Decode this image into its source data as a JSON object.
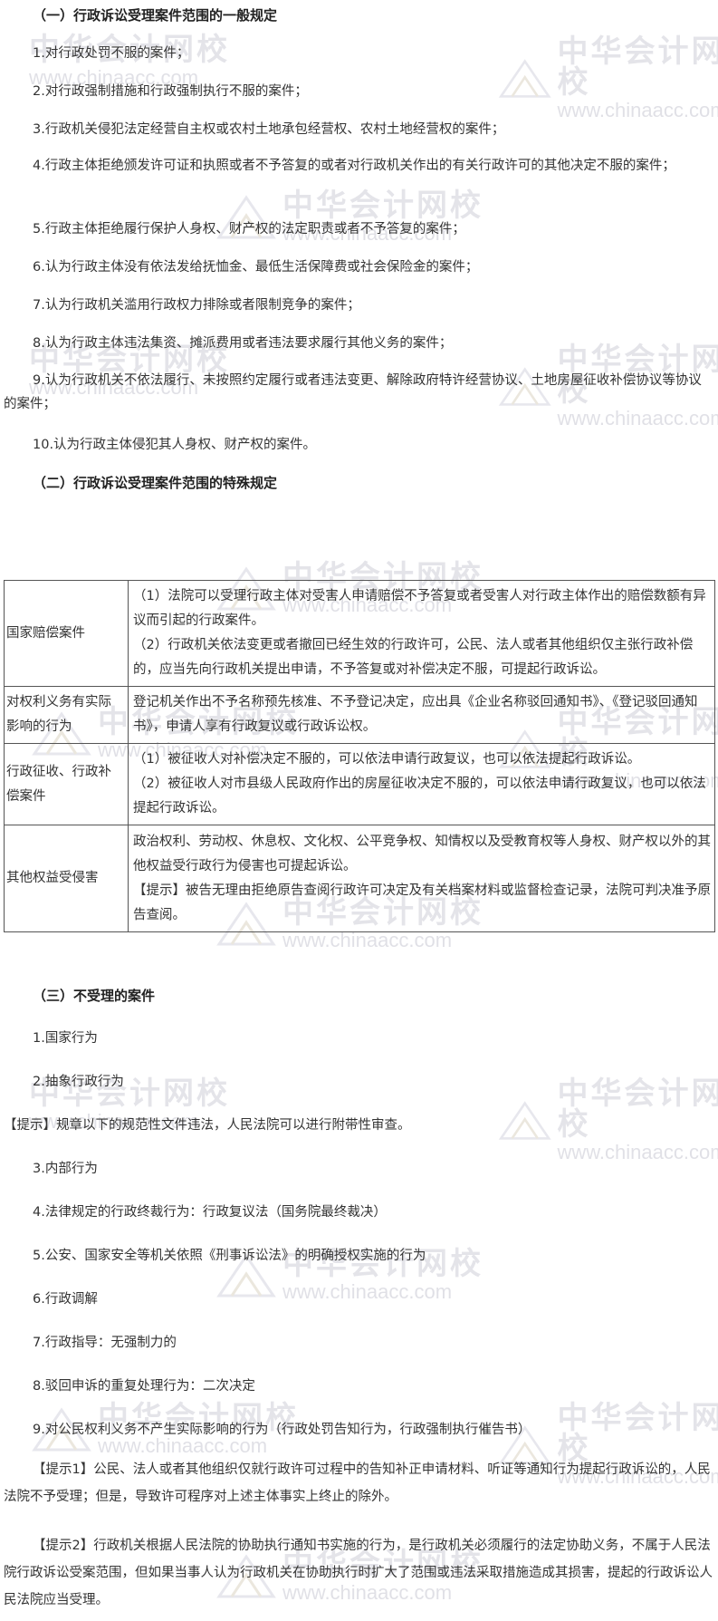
{
  "watermark": {
    "cn": "中华会计网校",
    "url": "www.chinaacc.com"
  },
  "section1": {
    "heading": "（一）行政诉讼受理案件范围的一般规定",
    "items": [
      "1.对行政处罚不服的案件；",
      "2.对行政强制措施和行政强制执行不服的案件；",
      "3.行政机关侵犯法定经营自主权或农村土地承包经营权、农村土地经营权的案件；",
      "4.行政主体拒绝颁发许可证和执照或者不予答复的或者对行政机关作出的有关行政许可的其他决定不服的案件；",
      "5.行政主体拒绝履行保护人身权、财产权的法定职责或者不予答复的案件；",
      "6.认为行政主体没有依法发给抚恤金、最低生活保障费或社会保险金的案件；",
      "7.认为行政机关滥用行政权力排除或者限制竞争的案件；",
      "8.认为行政主体违法集资、摊派费用或者违法要求履行其他义务的案件；",
      "9.认为行政机关不依法履行、未按照约定履行或者违法变更、解除政府特许经营协议、土地房屋征收补偿协议等协议的案件；",
      "10.认为行政主体侵犯其人身权、财产权的案件。"
    ]
  },
  "section2": {
    "heading": "（二）行政诉讼受理案件范围的特殊规定",
    "rows": [
      {
        "key": "国家赔偿案件",
        "lines": [
          "（1）法院可以受理行政主体对受害人申请赔偿不予答复或者受害人对行政主体作出的赔偿数额有异议而引起的行政案件。",
          "（2）行政机关依法变更或者撤回已经生效的行政许可，公民、法人或者其他组织仅主张行政补偿的，应当先向行政机关提出申请，不予答复或对补偿决定不服，可提起行政诉讼。"
        ]
      },
      {
        "key": "对权利义务有实际影响的行为",
        "lines": [
          "登记机关作出不予名称预先核准、不予登记决定，应出具《企业名称驳回通知书》、《登记驳回通知书》，申请人享有行政复议或行政诉讼权。"
        ]
      },
      {
        "key": "行政征收、行政补偿案件",
        "lines": [
          "（1）被征收人对补偿决定不服的，可以依法申请行政复议，也可以依法提起行政诉讼。",
          "（2）被征收人对市县级人民政府作出的房屋征收决定不服的，可以依法申请行政复议，也可以依法提起行政诉讼。"
        ]
      },
      {
        "key": "其他权益受侵害",
        "lines": [
          "政治权利、劳动权、休息权、文化权、公平竞争权、知情权以及受教育权等人身权、财产权以外的其他权益受行政行为侵害也可提起诉讼。",
          "【提示】被告无理由拒绝原告查阅行政许可决定及有关档案材料或监督检查记录，法院可判决准予原告查阅。"
        ]
      }
    ]
  },
  "section3": {
    "heading": "（三）不受理的案件",
    "items": [
      "1.国家行为",
      "2.抽象行政行为",
      "【提示】规章以下的规范性文件违法，人民法院可以进行附带性审查。",
      "3.内部行为",
      "4.法律规定的行政终裁行为：行政复议法（国务院最终裁决）",
      "5.公安、国家安全等机关依照《刑事诉讼法》的明确授权实施的行为",
      "6.行政调解",
      "7.行政指导：无强制力的",
      "8.驳回申诉的重复处理行为：二次决定",
      "9.对公民权利义务不产生实际影响的行为（行政处罚告知行为，行政强制执行催告书）"
    ],
    "tip1": "【提示1】公民、法人或者其他组织仅就行政许可过程中的告知补正申请材料、听证等通知行为提起行政诉讼的，人民法院不予受理；但是，导致许可程序对上述主体事实上终止的除外。",
    "tip2": "【提示2】行政机关根据人民法院的协助执行通知书实施的行为，是行政机关必须履行的法定协助义务，不属于人民法院行政诉讼受案范围，但如果当事人认为行政机关在协助执行时扩大了范围或违法采取措施造成其损害，提起的行政诉讼人民法院应当受理。"
  }
}
